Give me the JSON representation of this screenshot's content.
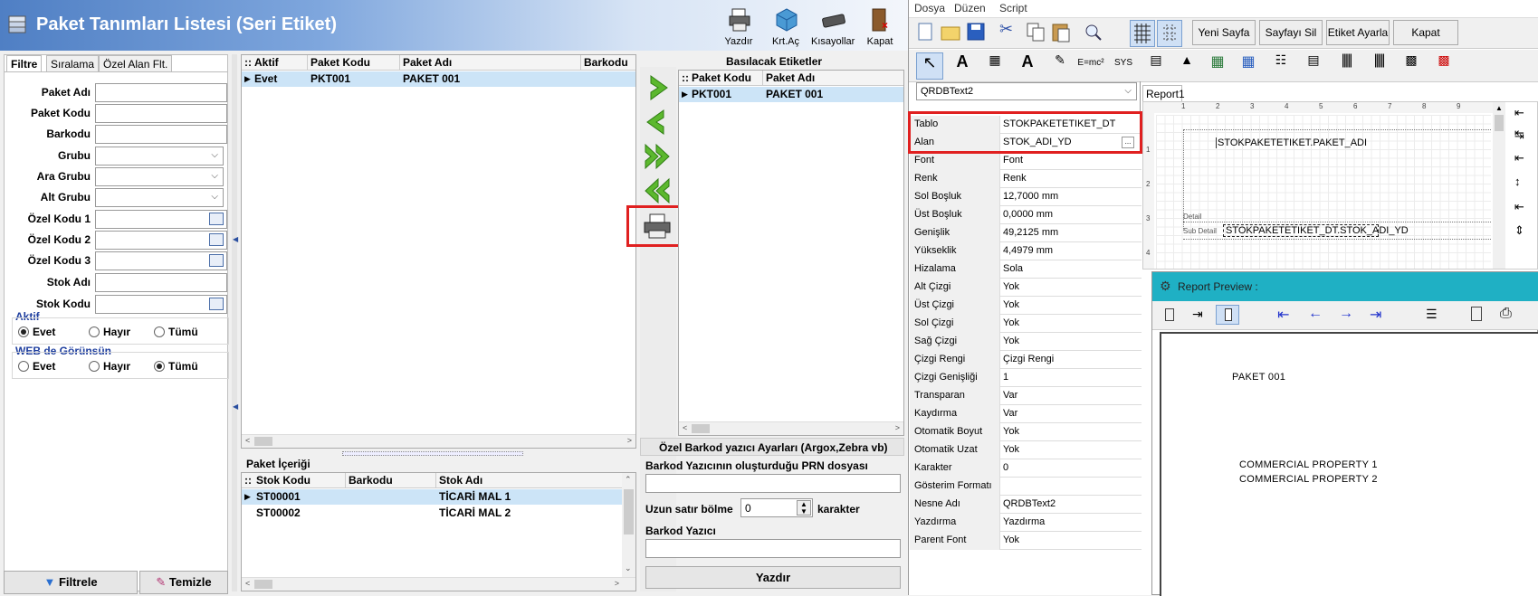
{
  "window": {
    "title": "Paket Tanımları Listesi (Seri Etiket)"
  },
  "toolbar": {
    "print": "Yazdır",
    "card_open": "Krt.Aç",
    "shortcuts": "Kısayollar",
    "close": "Kapat"
  },
  "filter_tabs": [
    "Filtre",
    "Sıralama",
    "Özel Alan Flt."
  ],
  "filter_fields": [
    {
      "label": "Paket Adı",
      "type": "text",
      "value": ""
    },
    {
      "label": "Paket Kodu",
      "type": "text",
      "value": ""
    },
    {
      "label": "Barkodu",
      "type": "text",
      "value": ""
    },
    {
      "label": "Grubu",
      "type": "combo",
      "value": ""
    },
    {
      "label": "Ara Grubu",
      "type": "combo",
      "value": ""
    },
    {
      "label": "Alt Grubu",
      "type": "combo",
      "value": ""
    },
    {
      "label": "Özel Kodu 1",
      "type": "lookup",
      "value": ""
    },
    {
      "label": "Özel Kodu 2",
      "type": "lookup",
      "value": ""
    },
    {
      "label": "Özel Kodu 3",
      "type": "lookup",
      "value": ""
    },
    {
      "label": "Stok Adı",
      "type": "text",
      "value": ""
    },
    {
      "label": "Stok Kodu",
      "type": "lookup",
      "value": ""
    }
  ],
  "active_group": {
    "title": "Aktif",
    "options": [
      "Evet",
      "Hayır",
      "Tümü"
    ],
    "selected": "Evet"
  },
  "web_group": {
    "title": "WEB de Görünsün",
    "options": [
      "Evet",
      "Hayır",
      "Tümü"
    ],
    "selected": "Tümü"
  },
  "filter_buttons": {
    "apply": "Filtrele",
    "clear": "Temizle"
  },
  "packages_grid": {
    "columns": [
      "Aktif",
      "Paket Kodu",
      "Paket Adı",
      "Barkodu"
    ],
    "rows": [
      [
        "Evet",
        "PKT001",
        "PAKET 001",
        ""
      ]
    ]
  },
  "content_grid": {
    "title": "Paket İçeriği",
    "columns": [
      "Stok Kodu",
      "Barkodu",
      "Stok Adı"
    ],
    "rows": [
      [
        "ST00001",
        "",
        "TİCARİ MAL 1"
      ],
      [
        "ST00002",
        "",
        "TİCARİ MAL 2"
      ]
    ]
  },
  "labels_panel": {
    "title": "Basılacak Etiketler",
    "columns": [
      "Paket Kodu",
      "Paket Adı"
    ],
    "rows": [
      [
        "PKT001",
        "PAKET 001"
      ]
    ]
  },
  "barcode_printer": {
    "title": "Özel Barkod yazıcı Ayarları (Argox,Zebra vb)",
    "prn_label": "Barkod Yazıcının oluşturduğu PRN dosyası",
    "prn_value": "",
    "split_label": "Uzun satır bölme",
    "split_value": "0",
    "split_unit": "karakter",
    "printer_label": "Barkod Yazıcı",
    "printer_value": "",
    "print_button": "Yazdır"
  },
  "designer": {
    "menu": [
      "Dosya",
      "Düzen",
      "Script"
    ],
    "buttons": [
      "Yeni Sayfa",
      "Sayfayı Sil",
      "Etiket Ayarla",
      "Kapat"
    ],
    "component_combo": "QRDBText2",
    "properties": [
      [
        "Tablo",
        "STOKPAKETETIKET_DT"
      ],
      [
        "Alan",
        "STOK_ADI_YD"
      ],
      [
        "Font",
        "Font"
      ],
      [
        "Renk",
        "Renk"
      ],
      [
        "Sol Boşluk",
        "12,7000 mm"
      ],
      [
        "Üst Boşluk",
        "0,0000 mm"
      ],
      [
        "Genişlik",
        "49,2125 mm"
      ],
      [
        "Yükseklik",
        "4,4979 mm"
      ],
      [
        "Hizalama",
        "Sola"
      ],
      [
        "Alt Çizgi",
        "Yok"
      ],
      [
        "Üst Çizgi",
        "Yok"
      ],
      [
        "Sol Çizgi",
        "Yok"
      ],
      [
        "Sağ Çizgi",
        "Yok"
      ],
      [
        "Çizgi Rengi",
        "Çizgi Rengi"
      ],
      [
        "Çizgi Genişliği",
        "1"
      ],
      [
        "Transparan",
        "Var"
      ],
      [
        "Kaydırma",
        "Var"
      ],
      [
        "Otomatik Boyut",
        "Yok"
      ],
      [
        "Otomatik Uzat",
        "Yok"
      ],
      [
        "Karakter",
        "0"
      ],
      [
        "Gösterim Formatı",
        ""
      ],
      [
        "Nesne Adı",
        "QRDBText2"
      ],
      [
        "Yazdırma",
        "Yazdırma"
      ],
      [
        "Parent Font",
        "Yok"
      ]
    ],
    "report_tab": "Report1",
    "ruler_h": [
      "1",
      "2",
      "3",
      "4",
      "5",
      "6",
      "7",
      "8",
      "9"
    ],
    "ruler_v": [
      "1",
      "2",
      "3",
      "4"
    ],
    "field_header": "STOKPAKETETIKET.PAKET_ADI",
    "band_detail": "Detail",
    "band_subdetail": "Sub Detail",
    "field_detail": "STOKPAKETETIKET_DT.STOK_ADI_YD"
  },
  "preview": {
    "title": "Report Preview :",
    "line1": "PAKET 001",
    "line2": "COMMERCIAL PROPERTY 1",
    "line3": "COMMERCIAL PROPERTY 2"
  }
}
